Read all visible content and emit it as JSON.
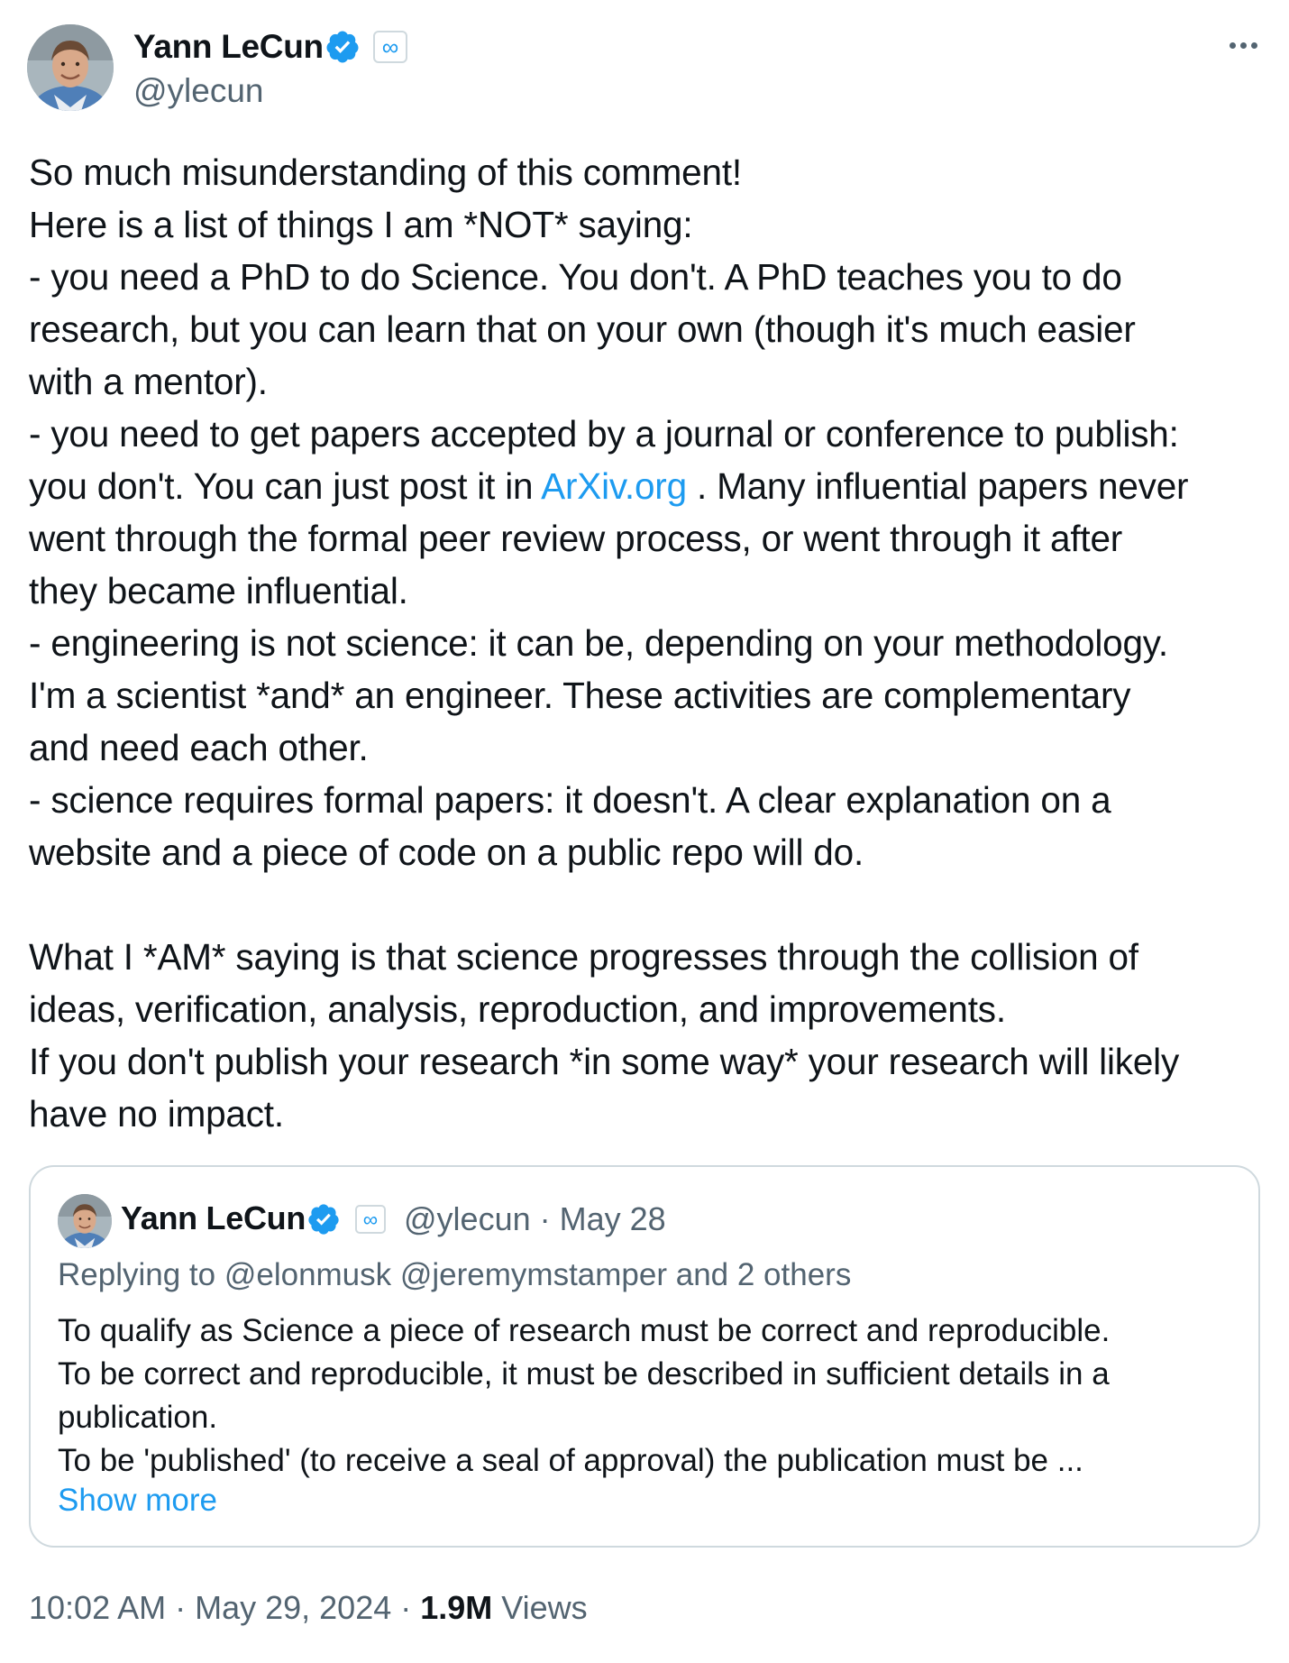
{
  "author": {
    "name": "Yann LeCun",
    "handle": "@ylecun",
    "affiliation_glyph": "∞"
  },
  "more_glyph": "•••",
  "tweet": {
    "lines": [
      "So much misunderstanding of this comment!",
      "Here is a list of things I am *NOT* saying:",
      "- you need a PhD to do Science. You don't. A PhD teaches you to do",
      "research, but you can learn that on your own (though it's much easier",
      "with a mentor).",
      "- you need to get papers accepted by a journal or conference to publish:",
      "you don't. You can just post it in ",
      "went through the formal peer review process, or went through it after",
      "they became influential.",
      "- engineering is not science: it can be, depending on your methodology.",
      "I'm a scientist *and* an engineer. These activities are complementary",
      "and need each other.",
      "- science requires formal papers: it doesn't. A clear explanation on a",
      "website and a piece of code on a public repo will do.",
      "",
      "What I *AM* saying is that science progresses through the collision of",
      "ideas, verification, analysis, reproduction, and improvements.",
      "If you don't publish your research *in some way* your research will likely",
      "have no impact."
    ],
    "link_text": "ArXiv.org",
    "after_link": " . Many influential papers never"
  },
  "quote": {
    "name": "Yann LeCun",
    "affiliation_glyph": "∞",
    "meta": "@ylecun · May 28",
    "replying": "Replying to @elonmusk @jeremymstamper and 2 others",
    "lines": [
      "To qualify as Science a piece of research must be correct and reproducible.",
      "To be correct and reproducible, it must be described in sufficient details in a",
      "publication.",
      "To be 'published' (to receive a seal of approval) the publication must be ..."
    ],
    "show_more": "Show more"
  },
  "footer": {
    "time": "10:02 AM · May 29, 2024 · ",
    "views_count": "1.9M",
    "views_label": " Views"
  },
  "colors": {
    "accent": "#1d9bf0",
    "text": "#0f1419",
    "secondary": "#536471",
    "border": "#cfd9de"
  }
}
